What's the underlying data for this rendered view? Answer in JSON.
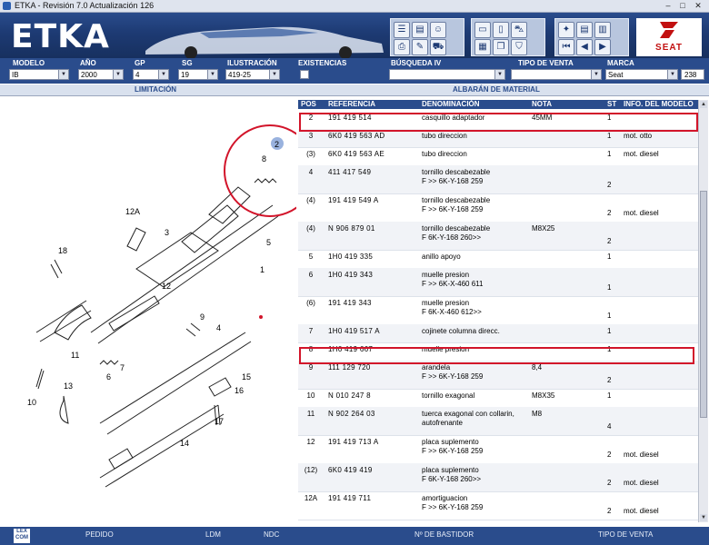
{
  "window": {
    "title": "ETKA - Revisión 7.0 Actualización 126",
    "min": "–",
    "max": "□",
    "close": "✕"
  },
  "banner": {
    "logo": "ETKA",
    "brand": "SEAT"
  },
  "filters": [
    {
      "label": "MODELO",
      "value": "IB"
    },
    {
      "label": "AÑO",
      "value": "2000"
    },
    {
      "label": "GP",
      "value": "4"
    },
    {
      "label": "SG",
      "value": "19"
    },
    {
      "label": "ILUSTRACIÓN",
      "value": "419-25"
    },
    {
      "label": "EXISTENCIAS",
      "value": ""
    },
    {
      "label": "BÚSQUEDA IV",
      "value": ""
    },
    {
      "label": "TIPO DE VENTA",
      "value": ""
    },
    {
      "label": "MARCA",
      "value": "Seat"
    }
  ],
  "marca_count": "238",
  "subheader": {
    "left": "LIMITACIÓN",
    "right": "ALBARÁN DE MATERIAL"
  },
  "table": {
    "headers": [
      "POS",
      "REFERENCIA",
      "DENOMINACIÓN",
      "NOTA",
      "ST",
      "INFO. DEL MODELO"
    ],
    "rows": [
      {
        "pos": "2",
        "ref": "191  419  514",
        "den": "casquillo adaptador",
        "den2": "",
        "nota": "45MM",
        "st": "1",
        "info": ""
      },
      {
        "pos": "3",
        "ref": "6K0  419  563  AD",
        "den": "tubo direccion",
        "den2": "",
        "nota": "",
        "st": "1",
        "info": "mot. otto"
      },
      {
        "pos": "(3)",
        "ref": "6K0  419  563  AE",
        "den": "tubo direccion",
        "den2": "",
        "nota": "",
        "st": "1",
        "info": "mot. diesel"
      },
      {
        "pos": "4",
        "ref": "411  417  549",
        "den": "tornillo descabezable",
        "den2": "F          >> 6K-Y-168 259",
        "nota": "",
        "st": "2",
        "info": ""
      },
      {
        "pos": "(4)",
        "ref": "191  419  549  A",
        "den": "tornillo descabezable",
        "den2": "F          >> 6K-Y-168 259",
        "nota": "",
        "st": "2",
        "info": "mot. diesel"
      },
      {
        "pos": "(4)",
        "ref": "N    906  879  01",
        "den": "tornillo descabezable",
        "den2": "F 6K-Y-168 260>>",
        "nota": "M8X25",
        "st": "2",
        "info": ""
      },
      {
        "pos": "5",
        "ref": "1H0  419  335",
        "den": "anillo apoyo",
        "den2": "",
        "nota": "",
        "st": "1",
        "info": ""
      },
      {
        "pos": "6",
        "ref": "1H0  419  343",
        "den": "muelle presion",
        "den2": "F          >> 6K-X-460 611",
        "nota": "",
        "st": "1",
        "info": ""
      },
      {
        "pos": "(6)",
        "ref": "191  419  343",
        "den": "muelle presion",
        "den2": "F 6K-X-460 612>>",
        "nota": "",
        "st": "1",
        "info": ""
      },
      {
        "pos": "7",
        "ref": "1H0  419  517  A",
        "den": "cojinete columna direcc.",
        "den2": "",
        "nota": "",
        "st": "1",
        "info": ""
      },
      {
        "pos": "8",
        "ref": "1H0  419  667",
        "den": "muelle presion",
        "den2": "",
        "nota": "",
        "st": "1",
        "info": ""
      },
      {
        "pos": "9",
        "ref": "111  129  720",
        "den": "arandela",
        "den2": "F          >> 6K-Y-168 259",
        "nota": "8,4",
        "st": "2",
        "info": ""
      },
      {
        "pos": "10",
        "ref": "N    010  247  8",
        "den": "tornillo exagonal",
        "den2": "",
        "nota": "M8X35",
        "st": "1",
        "info": ""
      },
      {
        "pos": "11",
        "ref": "N    902  264  03",
        "den": "tuerca exagonal con collarin,",
        "den2": "autofrenante",
        "nota": "M8",
        "st": "4",
        "info": ""
      },
      {
        "pos": "12",
        "ref": "191  419  713  A",
        "den": "placa suplemento",
        "den2": "F          >> 6K-Y-168 259",
        "nota": "",
        "st": "2",
        "info": "mot. diesel"
      },
      {
        "pos": "(12)",
        "ref": "6K0  419  419",
        "den": "placa suplemento",
        "den2": "F 6K-Y-168 260>>",
        "nota": "",
        "st": "2",
        "info": "mot. diesel"
      },
      {
        "pos": "12A",
        "ref": "191  419  711",
        "den": "amortiguacion",
        "den2": "F          >> 6K-Y-168 259",
        "nota": "",
        "st": "2",
        "info": "mot. diesel"
      }
    ]
  },
  "diagram": {
    "callouts": [
      "2",
      "3",
      "4",
      "5",
      "6",
      "7",
      "8",
      "9",
      "10",
      "11",
      "12",
      "12A",
      "13",
      "14",
      "15",
      "16",
      "17",
      "18",
      "1"
    ]
  },
  "statusbar": {
    "logo": "LEX COM",
    "buttons": [
      "PEDIDO",
      "LDM",
      "NDC",
      "Nº DE BASTIDOR",
      "TIPO DE VENTA"
    ]
  },
  "colors": {
    "primary": "#2a4c8c",
    "highlight": "#d2142a"
  }
}
